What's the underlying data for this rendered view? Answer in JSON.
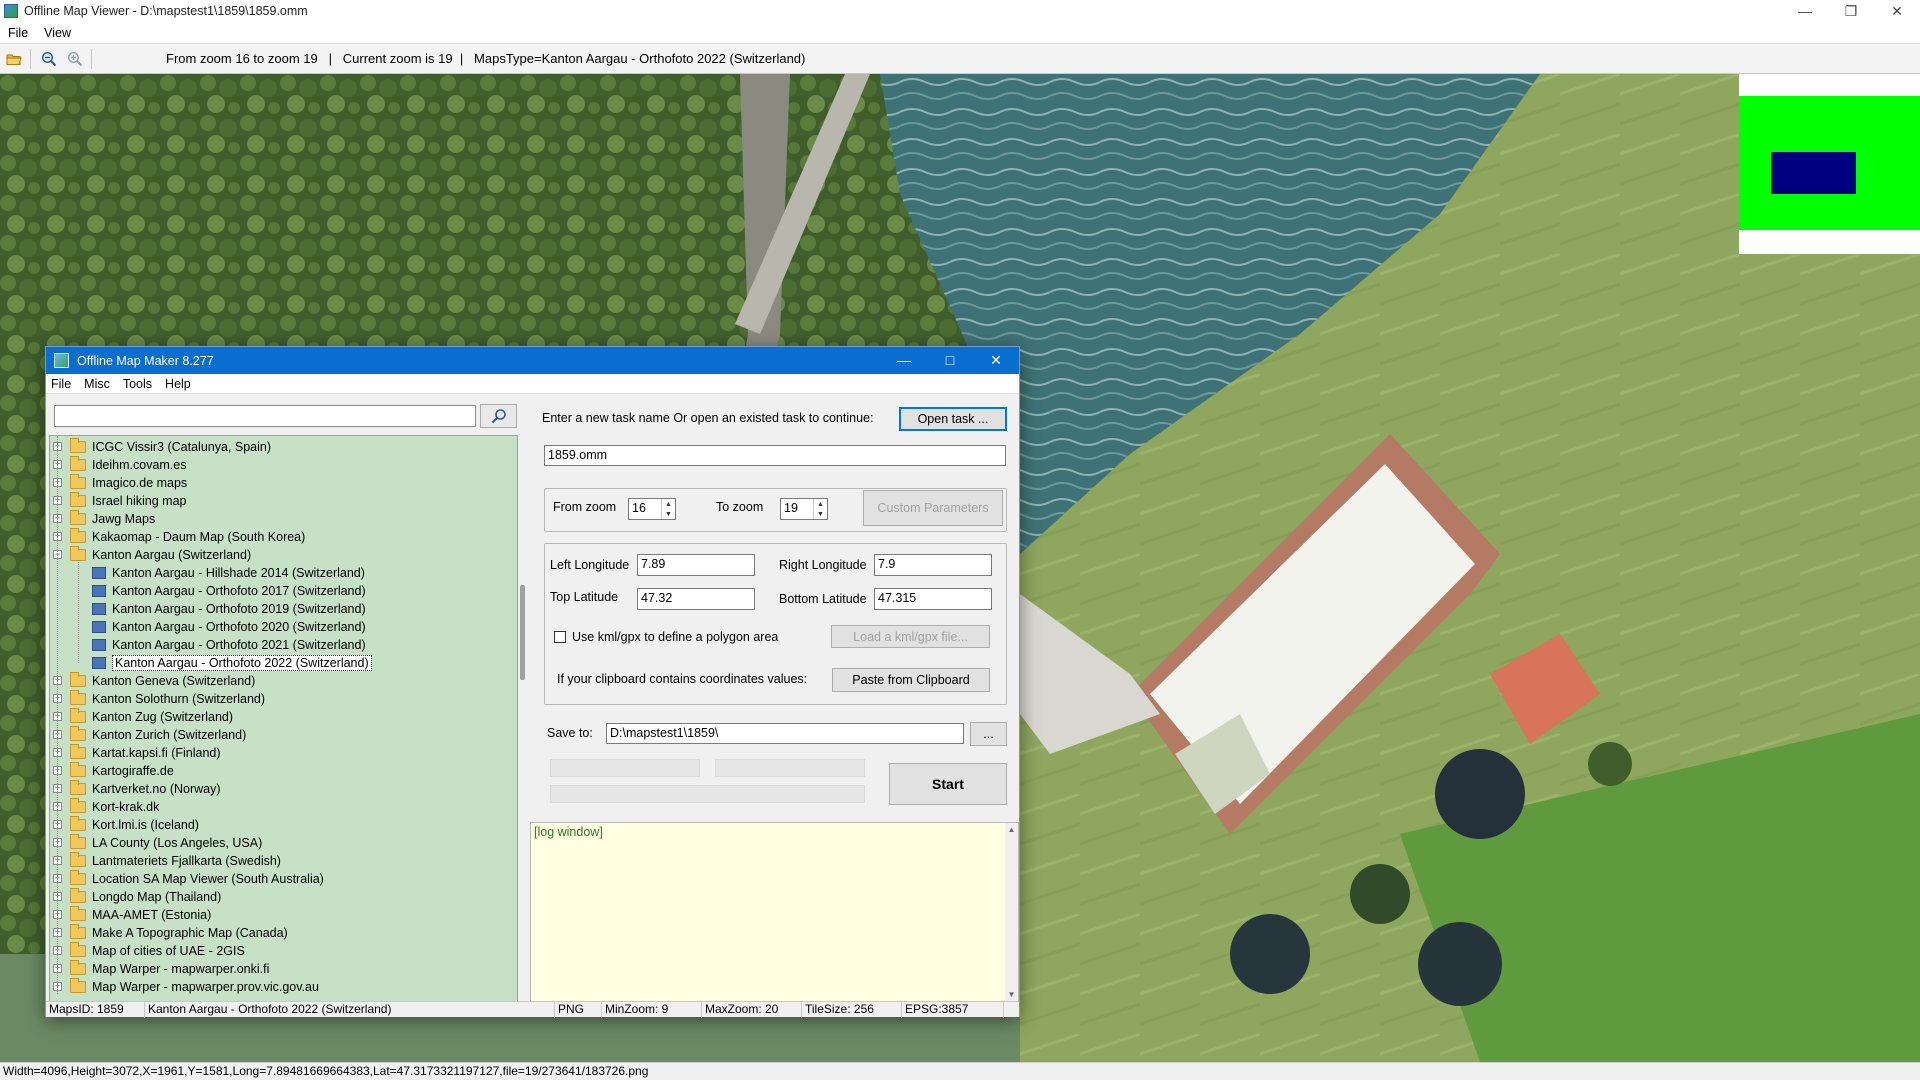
{
  "viewer": {
    "title": "Offline Map Viewer - D:\\mapstest1\\1859\\1859.omm",
    "menu": [
      "File",
      "View"
    ],
    "toolbar_status": "From zoom 16 to zoom 19   |   Current zoom is 19  |   MapsType=Kanton Aargau - Orthofoto 2022 (Switzerland)",
    "statusbar": "Width=4096,Height=3072,X=1961,Y=1581,Long=7.89481669664383,Lat=47.3173321197127,file=19/273641/183726.png"
  },
  "dialog": {
    "title": "Offline Map Maker 8.277",
    "menu": [
      "File",
      "Misc",
      "Tools",
      "Help"
    ],
    "search_placeholder": "",
    "tree": [
      {
        "label": "ICGC Vissir3 (Catalunya, Spain)",
        "type": "folder",
        "level": 0
      },
      {
        "label": "Ideihm.covam.es",
        "type": "folder",
        "level": 0
      },
      {
        "label": "Imagico.de maps",
        "type": "folder",
        "level": 0
      },
      {
        "label": "Israel hiking map",
        "type": "folder",
        "level": 0
      },
      {
        "label": "Jawg Maps",
        "type": "folder",
        "level": 0
      },
      {
        "label": "Kakaomap - Daum Map (South Korea)",
        "type": "folder",
        "level": 0
      },
      {
        "label": "Kanton Aargau (Switzerland)",
        "type": "folder-open",
        "level": 0
      },
      {
        "label": "Kanton Aargau - Hillshade 2014 (Switzerland)",
        "type": "map",
        "level": 1
      },
      {
        "label": "Kanton Aargau - Orthofoto 2017 (Switzerland)",
        "type": "map",
        "level": 1
      },
      {
        "label": "Kanton Aargau - Orthofoto 2019 (Switzerland)",
        "type": "map",
        "level": 1
      },
      {
        "label": "Kanton Aargau - Orthofoto 2020 (Switzerland)",
        "type": "map",
        "level": 1
      },
      {
        "label": "Kanton Aargau - Orthofoto 2021 (Switzerland)",
        "type": "map",
        "level": 1
      },
      {
        "label": "Kanton Aargau - Orthofoto 2022 (Switzerland)",
        "type": "map",
        "level": 1,
        "selected": true
      },
      {
        "label": "Kanton Geneva (Switzerland)",
        "type": "folder",
        "level": 0
      },
      {
        "label": "Kanton Solothurn (Switzerland)",
        "type": "folder",
        "level": 0
      },
      {
        "label": "Kanton Zug (Switzerland)",
        "type": "folder",
        "level": 0
      },
      {
        "label": "Kanton Zurich (Switzerland)",
        "type": "folder",
        "level": 0
      },
      {
        "label": "Kartat.kapsi.fi (Finland)",
        "type": "folder",
        "level": 0
      },
      {
        "label": "Kartogiraffe.de",
        "type": "folder",
        "level": 0
      },
      {
        "label": "Kartverket.no (Norway)",
        "type": "folder",
        "level": 0
      },
      {
        "label": "Kort-krak.dk",
        "type": "folder",
        "level": 0
      },
      {
        "label": "Kort.lmi.is (Iceland)",
        "type": "folder",
        "level": 0
      },
      {
        "label": "LA County (Los Angeles, USA)",
        "type": "folder",
        "level": 0
      },
      {
        "label": "Lantmateriets Fjallkarta (Swedish)",
        "type": "folder",
        "level": 0
      },
      {
        "label": "Location SA Map Viewer (South Australia)",
        "type": "folder",
        "level": 0
      },
      {
        "label": "Longdo Map (Thailand)",
        "type": "folder",
        "level": 0
      },
      {
        "label": "MAA-AMET (Estonia)",
        "type": "folder",
        "level": 0
      },
      {
        "label": "Make A Topographic Map (Canada)",
        "type": "folder",
        "level": 0
      },
      {
        "label": "Map of cities of UAE - 2GIS",
        "type": "folder",
        "level": 0
      },
      {
        "label": "Map Warper - mapwarper.onki.fi",
        "type": "folder",
        "level": 0
      },
      {
        "label": "Map Warper - mapwarper.prov.vic.gov.au",
        "type": "folder",
        "level": 0
      }
    ],
    "task_label": "Enter a new task name Or open an existed task to continue:",
    "open_task_label": "Open task ...",
    "task_name": "1859.omm",
    "from_zoom_label": "From zoom",
    "from_zoom": "16",
    "to_zoom_label": "To zoom",
    "to_zoom": "19",
    "custom_params_label": "Custom Parameters",
    "left_lon_label": "Left Longitude",
    "left_lon": "7.89",
    "right_lon_label": "Right Longitude",
    "right_lon": "7.9",
    "top_lat_label": "Top Latitude",
    "top_lat": "47.32",
    "bottom_lat_label": "Bottom Latitude",
    "bottom_lat": "47.315",
    "kml_check_label": "Use kml/gpx to define a polygon area",
    "load_kml_label": "Load a kml/gpx file...",
    "clipboard_label": "If your clipboard contains coordinates values:",
    "paste_label": "Paste from Clipboard",
    "save_to_label": "Save to:",
    "save_to": "D:\\mapstest1\\1859\\",
    "browse_label": "...",
    "start_label": "Start",
    "log_text": "[log window]",
    "status": {
      "maps_id": "MapsID: 1859",
      "map_name": "Kanton Aargau - Orthofoto 2022 (Switzerland)",
      "format": "PNG",
      "min_zoom": "MinZoom: 9",
      "max_zoom": "MaxZoom: 20",
      "tile_size": "TileSize: 256",
      "epsg": "EPSG:3857"
    }
  },
  "colors": {
    "dialog_title": "#0a6ed1",
    "tree_bg": "#c7e1c7",
    "log_bg": "#ffffe1",
    "overview_green": "#00ff00",
    "overview_blue": "#000080"
  }
}
